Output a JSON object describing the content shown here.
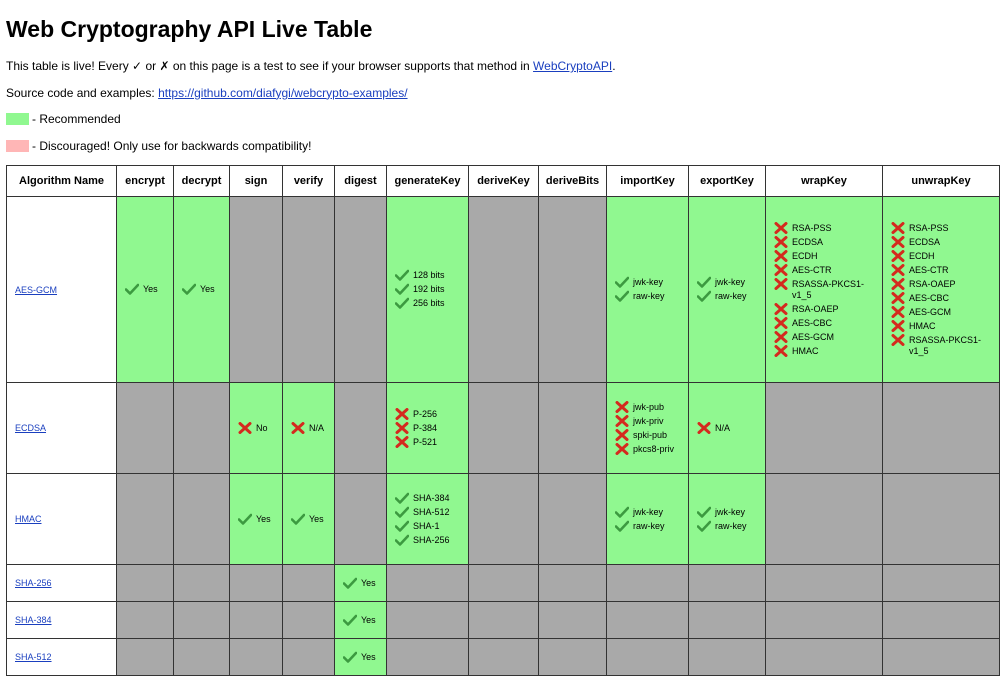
{
  "page": {
    "title": "Web Cryptography API Live Table",
    "intro_prefix": "This table is live! Every ",
    "intro_check": "✓",
    "intro_or": " or ",
    "intro_cross": "✗",
    "intro_suffix": " on this page is a test to see if your browser supports that method in ",
    "intro_link": "WebCryptoAPI",
    "intro_end": ".",
    "source_prefix": "Source code and examples: ",
    "source_link": "https://github.com/diafygi/webcrypto-examples/",
    "legend_recommended": "- Recommended",
    "legend_discouraged": "- Discouraged! Only use for backwards compatibility!"
  },
  "colors": {
    "recommended": "#90f890",
    "discouraged": "#ffb6b6",
    "unsupported": "#a9a9a9",
    "check": "#3c9a40",
    "cross": "#d42a1e",
    "link": "#1a3fbf"
  },
  "table": {
    "headers": [
      "Algorithm Name",
      "encrypt",
      "decrypt",
      "sign",
      "verify",
      "digest",
      "generateKey",
      "deriveKey",
      "deriveBits",
      "importKey",
      "exportKey",
      "wrapKey",
      "unwrapKey"
    ],
    "rows": [
      {
        "name": "AES-GCM",
        "cells": [
          {
            "state": "ok",
            "items": [
              {
                "icon": "check",
                "text": "Yes"
              }
            ]
          },
          {
            "state": "ok",
            "items": [
              {
                "icon": "check",
                "text": "Yes"
              }
            ]
          },
          {
            "state": "na",
            "items": []
          },
          {
            "state": "na",
            "items": []
          },
          {
            "state": "na",
            "items": []
          },
          {
            "state": "ok",
            "items": [
              {
                "icon": "check",
                "text": "128 bits"
              },
              {
                "icon": "check",
                "text": "192 bits"
              },
              {
                "icon": "check",
                "text": "256 bits"
              }
            ]
          },
          {
            "state": "na",
            "items": []
          },
          {
            "state": "na",
            "items": []
          },
          {
            "state": "ok",
            "items": [
              {
                "icon": "check",
                "text": "jwk-key"
              },
              {
                "icon": "check",
                "text": "raw-key"
              }
            ]
          },
          {
            "state": "ok",
            "items": [
              {
                "icon": "check",
                "text": "jwk-key"
              },
              {
                "icon": "check",
                "text": "raw-key"
              }
            ]
          },
          {
            "state": "ok",
            "items": [
              {
                "icon": "cross",
                "text": "RSA-PSS"
              },
              {
                "icon": "cross",
                "text": "ECDSA"
              },
              {
                "icon": "cross",
                "text": "ECDH"
              },
              {
                "icon": "cross",
                "text": "AES-CTR"
              },
              {
                "icon": "cross",
                "text": "RSASSA-PKCS1-v1_5"
              },
              {
                "icon": "cross",
                "text": "RSA-OAEP"
              },
              {
                "icon": "cross",
                "text": "AES-CBC"
              },
              {
                "icon": "cross",
                "text": "AES-GCM"
              },
              {
                "icon": "cross",
                "text": "HMAC"
              }
            ]
          },
          {
            "state": "ok",
            "items": [
              {
                "icon": "cross",
                "text": "RSA-PSS"
              },
              {
                "icon": "cross",
                "text": "ECDSA"
              },
              {
                "icon": "cross",
                "text": "ECDH"
              },
              {
                "icon": "cross",
                "text": "AES-CTR"
              },
              {
                "icon": "cross",
                "text": "RSA-OAEP"
              },
              {
                "icon": "cross",
                "text": "AES-CBC"
              },
              {
                "icon": "cross",
                "text": "AES-GCM"
              },
              {
                "icon": "cross",
                "text": "HMAC"
              },
              {
                "icon": "cross",
                "text": "RSASSA-PKCS1-v1_5"
              }
            ]
          }
        ]
      },
      {
        "name": "ECDSA",
        "cells": [
          {
            "state": "na",
            "items": []
          },
          {
            "state": "na",
            "items": []
          },
          {
            "state": "ok",
            "items": [
              {
                "icon": "cross",
                "text": "No"
              }
            ]
          },
          {
            "state": "ok",
            "items": [
              {
                "icon": "cross",
                "text": "N/A"
              }
            ]
          },
          {
            "state": "na",
            "items": []
          },
          {
            "state": "ok",
            "items": [
              {
                "icon": "cross",
                "text": "P-256"
              },
              {
                "icon": "cross",
                "text": "P-384"
              },
              {
                "icon": "cross",
                "text": "P-521"
              }
            ]
          },
          {
            "state": "na",
            "items": []
          },
          {
            "state": "na",
            "items": []
          },
          {
            "state": "ok",
            "items": [
              {
                "icon": "cross",
                "text": "jwk-pub"
              },
              {
                "icon": "cross",
                "text": "jwk-priv"
              },
              {
                "icon": "cross",
                "text": "spki-pub"
              },
              {
                "icon": "cross",
                "text": "pkcs8-priv"
              }
            ]
          },
          {
            "state": "ok",
            "items": [
              {
                "icon": "cross",
                "text": "N/A"
              }
            ]
          },
          {
            "state": "na",
            "items": []
          },
          {
            "state": "na",
            "items": []
          }
        ]
      },
      {
        "name": "HMAC",
        "cells": [
          {
            "state": "na",
            "items": []
          },
          {
            "state": "na",
            "items": []
          },
          {
            "state": "ok",
            "items": [
              {
                "icon": "check",
                "text": "Yes"
              }
            ]
          },
          {
            "state": "ok",
            "items": [
              {
                "icon": "check",
                "text": "Yes"
              }
            ]
          },
          {
            "state": "na",
            "items": []
          },
          {
            "state": "ok",
            "items": [
              {
                "icon": "check",
                "text": "SHA-384"
              },
              {
                "icon": "check",
                "text": "SHA-512"
              },
              {
                "icon": "check",
                "text": "SHA-1"
              },
              {
                "icon": "check",
                "text": "SHA-256"
              }
            ]
          },
          {
            "state": "na",
            "items": []
          },
          {
            "state": "na",
            "items": []
          },
          {
            "state": "ok",
            "items": [
              {
                "icon": "check",
                "text": "jwk-key"
              },
              {
                "icon": "check",
                "text": "raw-key"
              }
            ]
          },
          {
            "state": "ok",
            "items": [
              {
                "icon": "check",
                "text": "jwk-key"
              },
              {
                "icon": "check",
                "text": "raw-key"
              }
            ]
          },
          {
            "state": "na",
            "items": []
          },
          {
            "state": "na",
            "items": []
          }
        ]
      },
      {
        "name": "SHA-256",
        "cells": [
          {
            "state": "na",
            "items": []
          },
          {
            "state": "na",
            "items": []
          },
          {
            "state": "na",
            "items": []
          },
          {
            "state": "na",
            "items": []
          },
          {
            "state": "ok",
            "items": [
              {
                "icon": "check",
                "text": "Yes"
              }
            ]
          },
          {
            "state": "na",
            "items": []
          },
          {
            "state": "na",
            "items": []
          },
          {
            "state": "na",
            "items": []
          },
          {
            "state": "na",
            "items": []
          },
          {
            "state": "na",
            "items": []
          },
          {
            "state": "na",
            "items": []
          },
          {
            "state": "na",
            "items": []
          }
        ]
      },
      {
        "name": "SHA-384",
        "cells": [
          {
            "state": "na",
            "items": []
          },
          {
            "state": "na",
            "items": []
          },
          {
            "state": "na",
            "items": []
          },
          {
            "state": "na",
            "items": []
          },
          {
            "state": "ok",
            "items": [
              {
                "icon": "check",
                "text": "Yes"
              }
            ]
          },
          {
            "state": "na",
            "items": []
          },
          {
            "state": "na",
            "items": []
          },
          {
            "state": "na",
            "items": []
          },
          {
            "state": "na",
            "items": []
          },
          {
            "state": "na",
            "items": []
          },
          {
            "state": "na",
            "items": []
          },
          {
            "state": "na",
            "items": []
          }
        ]
      },
      {
        "name": "SHA-512",
        "cells": [
          {
            "state": "na",
            "items": []
          },
          {
            "state": "na",
            "items": []
          },
          {
            "state": "na",
            "items": []
          },
          {
            "state": "na",
            "items": []
          },
          {
            "state": "ok",
            "items": [
              {
                "icon": "check",
                "text": "Yes"
              }
            ]
          },
          {
            "state": "na",
            "items": []
          },
          {
            "state": "na",
            "items": []
          },
          {
            "state": "na",
            "items": []
          },
          {
            "state": "na",
            "items": []
          },
          {
            "state": "na",
            "items": []
          },
          {
            "state": "na",
            "items": []
          },
          {
            "state": "na",
            "items": []
          }
        ]
      }
    ]
  }
}
